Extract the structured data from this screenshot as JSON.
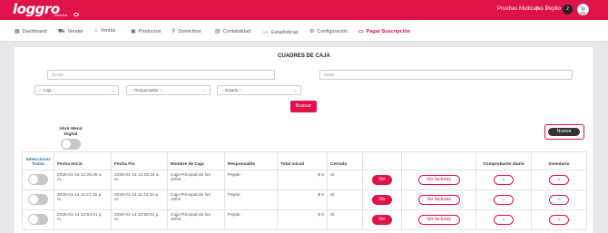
{
  "header": {
    "logo": "loggro",
    "logo_sub": "restobar",
    "company": "Pruebas Multicajas 1",
    "user": "Pepito",
    "notifications": "2"
  },
  "nav": [
    {
      "label": "Dashboard",
      "icon": "dashboard-icon"
    },
    {
      "label": "Vender",
      "icon": "cart-icon"
    },
    {
      "label": "Ventas",
      "icon": "tag-icon"
    },
    {
      "label": "Productos",
      "icon": "box-icon"
    },
    {
      "label": "Domicilios",
      "icon": "bike-icon"
    },
    {
      "label": "Contabilidad",
      "icon": "calculator-icon"
    },
    {
      "label": "Estadísticas",
      "icon": "chart-icon"
    },
    {
      "label": "Configuración",
      "icon": "gear-icon"
    },
    {
      "label": "Pagar Suscripción",
      "icon": "credit-card-icon"
    }
  ],
  "page": {
    "title": "CUADRES DE CAJA",
    "desde_placeholder": "Desde",
    "hasta_placeholder": "Hasta",
    "caja_select": "-- Caja --",
    "responsable_select": "-- Responsable --",
    "estado_select": "-- Estado --",
    "buscar": "Buscar",
    "abrir_menu": "Abrir Menú Digital",
    "nueva": "Nueva"
  },
  "table": {
    "headers": {
      "seleccionar": "Seleccionar Todas",
      "fecha_inicio": "Fecha Inicio",
      "fecha_fin": "Fecha Fin",
      "nombre_caja": "Nombre de Caja",
      "responsable": "Responsable",
      "total_inicial": "Total inicial",
      "cerrada": "Cerrada",
      "comprobante": "Comprobante diario",
      "inventario": "Inventario"
    },
    "ver_label": "Ver",
    "ver_facturas_label": "Ver facturas",
    "rows": [
      {
        "fecha_inicio": "2025-01-15 12:25:46 a. m.",
        "fecha_fin": "2025-01-15 12:26:16 a. m.",
        "nombre_caja": "Caja Principal de los Jefes",
        "responsable": "Pepito",
        "total_inicial": "$ 0",
        "cerrada": "Si"
      },
      {
        "fecha_inicio": "2025-01-14 11:21:15 p. m.",
        "fecha_fin": "2025-01-14 11:14:34 p. m.",
        "nombre_caja": "Caja Principal de los Jefes",
        "responsable": "Pepito",
        "total_inicial": "$ 0",
        "cerrada": "Si"
      },
      {
        "fecha_inicio": "2025-01-14 10:54:01 p. m.",
        "fecha_fin": "2025-01-14 10:55:01 p. m.",
        "nombre_caja": "Caja Principal de los Jefes",
        "responsable": "Pepito",
        "total_inicial": "$ 0",
        "cerrada": "Si"
      }
    ]
  },
  "colors": {
    "brand": "#e0124a",
    "link": "#1f6fb8"
  }
}
